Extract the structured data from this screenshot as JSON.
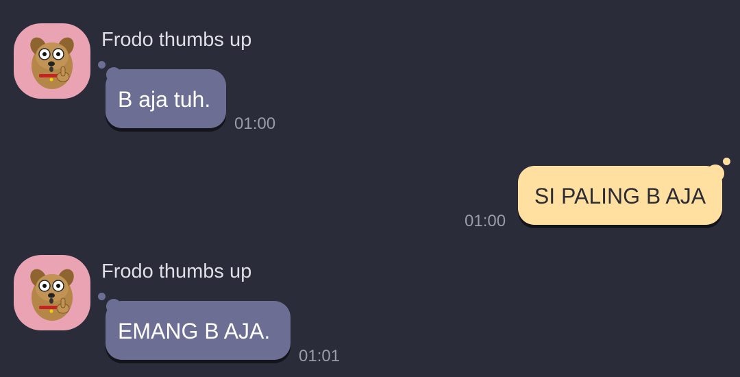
{
  "messages": [
    {
      "sender": "Frodo thumbs up",
      "text": "B aja tuh.",
      "time": "01:00",
      "avatar_icon": "dog-thumbs-up-icon"
    },
    {
      "text": "SI PALING B AJA",
      "time": "01:00"
    },
    {
      "sender": "Frodo thumbs up",
      "text": "EMANG B AJA.",
      "time": "01:01",
      "avatar_icon": "dog-thumbs-up-icon"
    }
  ],
  "colors": {
    "background": "#2b2c39",
    "incoming_bubble": "#6c6e94",
    "outgoing_bubble": "#ffe0a0",
    "avatar_background": "#e9a3b2",
    "timestamp": "#9a9ca8"
  }
}
